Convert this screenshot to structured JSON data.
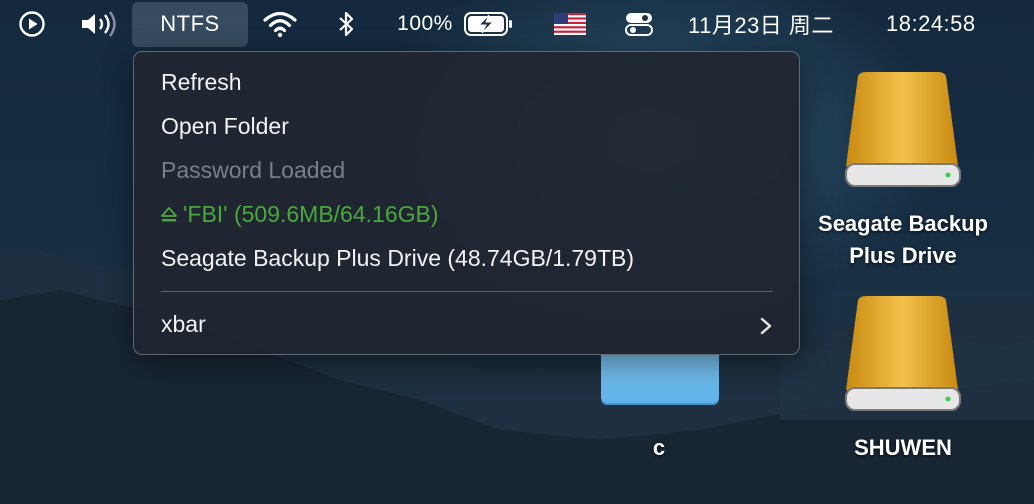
{
  "menubar": {
    "app_label": "NTFS",
    "battery_text": "100%",
    "date_text": "11月23日 周二",
    "time_text": "18:24:58",
    "icons": [
      "play-circle-icon",
      "volume-icon",
      "wifi-icon",
      "bluetooth-icon",
      "battery-charging-icon",
      "us-flag-icon",
      "control-center-icon"
    ]
  },
  "menu": {
    "items": [
      {
        "label": "Refresh",
        "enabled": true
      },
      {
        "label": "Open Folder",
        "enabled": true
      },
      {
        "label": "Password Loaded",
        "enabled": false
      },
      {
        "label": "'FBI' (509.6MB/64.16GB)",
        "enabled": true,
        "color": "#49a93a",
        "icon": "eject-icon"
      },
      {
        "label": "Seagate Backup Plus Drive (48.74GB/1.79TB)",
        "enabled": true
      }
    ],
    "submenu_label": "xbar"
  },
  "desktop": {
    "drive1_line1": "Seagate Backup",
    "drive1_line2": "Plus Drive",
    "drive2_label": "SHUWEN",
    "folder_label": "c"
  }
}
